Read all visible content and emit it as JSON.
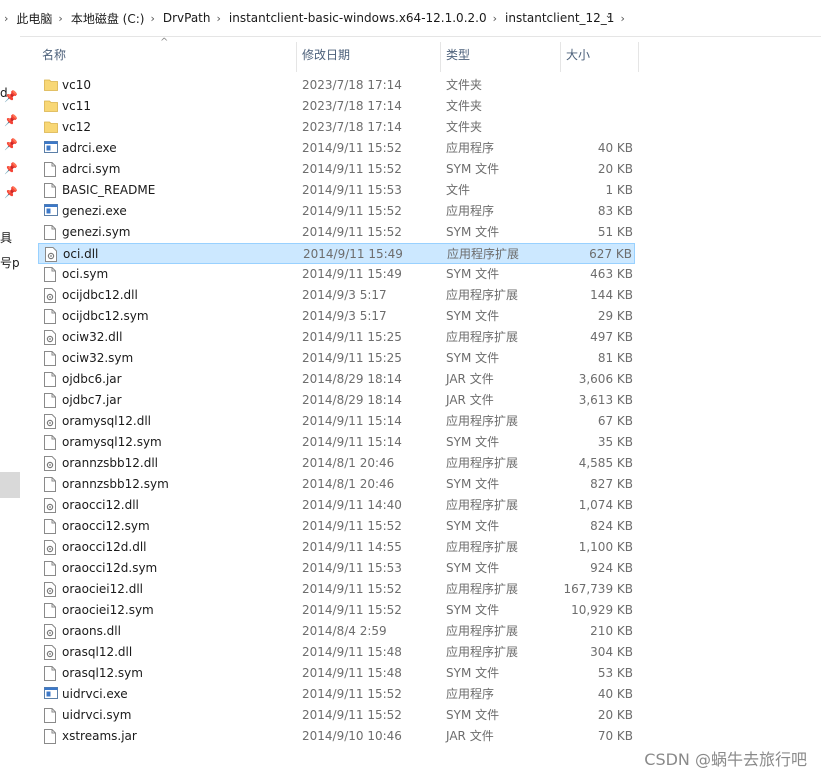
{
  "breadcrumb": {
    "items": [
      "此电脑",
      "本地磁盘 (C:)",
      "DrvPath",
      "instantclient-basic-windows.x64-12.1.0.2.0",
      "instantclient_12_1"
    ],
    "separator": "›",
    "dropdown": "⌄"
  },
  "nav_fragments": [
    "d",
    "具",
    "号pd"
  ],
  "columns": {
    "name": "名称",
    "modified": "修改日期",
    "type": "类型",
    "size": "大小",
    "sort_indicator": "^"
  },
  "files": [
    {
      "name": "vc10",
      "modified": "2023/7/18 17:14",
      "type": "文件夹",
      "size": "",
      "icon": "folder-icon"
    },
    {
      "name": "vc11",
      "modified": "2023/7/18 17:14",
      "type": "文件夹",
      "size": "",
      "icon": "folder-icon"
    },
    {
      "name": "vc12",
      "modified": "2023/7/18 17:14",
      "type": "文件夹",
      "size": "",
      "icon": "folder-icon"
    },
    {
      "name": "adrci.exe",
      "modified": "2014/9/11 15:52",
      "type": "应用程序",
      "size": "40 KB",
      "icon": "exe-icon"
    },
    {
      "name": "adrci.sym",
      "modified": "2014/9/11 15:52",
      "type": "SYM 文件",
      "size": "20 KB",
      "icon": "file-icon"
    },
    {
      "name": "BASIC_README",
      "modified": "2014/9/11 15:53",
      "type": "文件",
      "size": "1 KB",
      "icon": "file-icon"
    },
    {
      "name": "genezi.exe",
      "modified": "2014/9/11 15:52",
      "type": "应用程序",
      "size": "83 KB",
      "icon": "exe-icon"
    },
    {
      "name": "genezi.sym",
      "modified": "2014/9/11 15:52",
      "type": "SYM 文件",
      "size": "51 KB",
      "icon": "file-icon"
    },
    {
      "name": "oci.dll",
      "modified": "2014/9/11 15:49",
      "type": "应用程序扩展",
      "size": "627 KB",
      "icon": "dll-icon",
      "selected": true
    },
    {
      "name": "oci.sym",
      "modified": "2014/9/11 15:49",
      "type": "SYM 文件",
      "size": "463 KB",
      "icon": "file-icon"
    },
    {
      "name": "ocijdbc12.dll",
      "modified": "2014/9/3 5:17",
      "type": "应用程序扩展",
      "size": "144 KB",
      "icon": "dll-icon"
    },
    {
      "name": "ocijdbc12.sym",
      "modified": "2014/9/3 5:17",
      "type": "SYM 文件",
      "size": "29 KB",
      "icon": "file-icon"
    },
    {
      "name": "ociw32.dll",
      "modified": "2014/9/11 15:25",
      "type": "应用程序扩展",
      "size": "497 KB",
      "icon": "dll-icon"
    },
    {
      "name": "ociw32.sym",
      "modified": "2014/9/11 15:25",
      "type": "SYM 文件",
      "size": "81 KB",
      "icon": "file-icon"
    },
    {
      "name": "ojdbc6.jar",
      "modified": "2014/8/29 18:14",
      "type": "JAR 文件",
      "size": "3,606 KB",
      "icon": "file-icon"
    },
    {
      "name": "ojdbc7.jar",
      "modified": "2014/8/29 18:14",
      "type": "JAR 文件",
      "size": "3,613 KB",
      "icon": "file-icon"
    },
    {
      "name": "oramysql12.dll",
      "modified": "2014/9/11 15:14",
      "type": "应用程序扩展",
      "size": "67 KB",
      "icon": "dll-icon"
    },
    {
      "name": "oramysql12.sym",
      "modified": "2014/9/11 15:14",
      "type": "SYM 文件",
      "size": "35 KB",
      "icon": "file-icon"
    },
    {
      "name": "orannzsbb12.dll",
      "modified": "2014/8/1 20:46",
      "type": "应用程序扩展",
      "size": "4,585 KB",
      "icon": "dll-icon"
    },
    {
      "name": "orannzsbb12.sym",
      "modified": "2014/8/1 20:46",
      "type": "SYM 文件",
      "size": "827 KB",
      "icon": "file-icon"
    },
    {
      "name": "oraocci12.dll",
      "modified": "2014/9/11 14:40",
      "type": "应用程序扩展",
      "size": "1,074 KB",
      "icon": "dll-icon"
    },
    {
      "name": "oraocci12.sym",
      "modified": "2014/9/11 15:52",
      "type": "SYM 文件",
      "size": "824 KB",
      "icon": "file-icon"
    },
    {
      "name": "oraocci12d.dll",
      "modified": "2014/9/11 14:55",
      "type": "应用程序扩展",
      "size": "1,100 KB",
      "icon": "dll-icon"
    },
    {
      "name": "oraocci12d.sym",
      "modified": "2014/9/11 15:53",
      "type": "SYM 文件",
      "size": "924 KB",
      "icon": "file-icon"
    },
    {
      "name": "oraociei12.dll",
      "modified": "2014/9/11 15:52",
      "type": "应用程序扩展",
      "size": "167,739 KB",
      "icon": "dll-icon"
    },
    {
      "name": "oraociei12.sym",
      "modified": "2014/9/11 15:52",
      "type": "SYM 文件",
      "size": "10,929 KB",
      "icon": "file-icon"
    },
    {
      "name": "oraons.dll",
      "modified": "2014/8/4 2:59",
      "type": "应用程序扩展",
      "size": "210 KB",
      "icon": "dll-icon"
    },
    {
      "name": "orasql12.dll",
      "modified": "2014/9/11 15:48",
      "type": "应用程序扩展",
      "size": "304 KB",
      "icon": "dll-icon"
    },
    {
      "name": "orasql12.sym",
      "modified": "2014/9/11 15:48",
      "type": "SYM 文件",
      "size": "53 KB",
      "icon": "file-icon"
    },
    {
      "name": "uidrvci.exe",
      "modified": "2014/9/11 15:52",
      "type": "应用程序",
      "size": "40 KB",
      "icon": "exe-icon"
    },
    {
      "name": "uidrvci.sym",
      "modified": "2014/9/11 15:52",
      "type": "SYM 文件",
      "size": "20 KB",
      "icon": "file-icon"
    },
    {
      "name": "xstreams.jar",
      "modified": "2014/9/10 10:46",
      "type": "JAR 文件",
      "size": "70 KB",
      "icon": "file-icon"
    }
  ],
  "watermark": "CSDN @蜗牛去旅行吧",
  "colors": {
    "selection_bg": "#cce8ff",
    "selection_border": "#99d1ff",
    "folder": "#f8d775",
    "header_text": "#4c607a"
  }
}
